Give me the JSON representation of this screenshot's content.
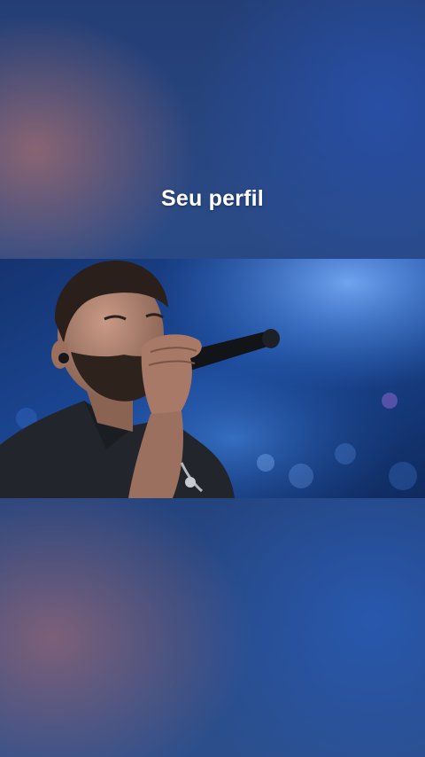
{
  "screen": {
    "overlay_title": "Seu perfil"
  },
  "video": {
    "scene": "singer-with-microphone-on-stage",
    "dominant_color": "#1c4a9a"
  }
}
